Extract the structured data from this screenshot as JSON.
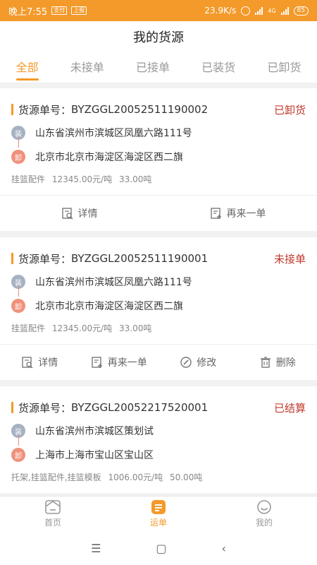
{
  "statusbar": {
    "time": "晚上7:55",
    "chip1": "支付",
    "chip2": "上报",
    "speed": "23.9K/s",
    "network": "4G",
    "battery": "85"
  },
  "title": "我的货源",
  "tabs": [
    "全部",
    "未接单",
    "已接单",
    "已装货",
    "已卸货"
  ],
  "orders": [
    {
      "no_label": "货源单号：",
      "no": "BYZGGL20052511190002",
      "status": "已卸货",
      "load_tag": "装",
      "unload_tag": "卸",
      "load_addr": "山东省滨州市滨城区凤凰六路111号",
      "unload_addr": "北京市北京市海淀区海淀区西二旗",
      "goods": "挂篮配件",
      "price": "12345.00元/吨",
      "weight": "33.00吨",
      "actions": [
        "详情",
        "再来一单"
      ]
    },
    {
      "no_label": "货源单号：",
      "no": "BYZGGL20052511190001",
      "status": "未接单",
      "load_tag": "装",
      "unload_tag": "卸",
      "load_addr": "山东省滨州市滨城区凤凰六路111号",
      "unload_addr": "北京市北京市海淀区海淀区西二旗",
      "goods": "挂篮配件",
      "price": "12345.00元/吨",
      "weight": "33.00吨",
      "actions": [
        "详情",
        "再来一单",
        "修改",
        "删除"
      ]
    },
    {
      "no_label": "货源单号：",
      "no": "BYZGGL20052217520001",
      "status": "已结算",
      "load_tag": "装",
      "unload_tag": "卸",
      "load_addr": "山东省滨州市滨城区策划试",
      "unload_addr": "上海市上海市宝山区宝山区",
      "goods": "托架,挂篮配件,挂篮模板",
      "price": "1006.00元/吨",
      "weight": "50.00吨"
    }
  ],
  "bottomnav": [
    "首页",
    "运单",
    "我的"
  ],
  "colors": {
    "accent": "#f39a2b",
    "status": "#c0392b",
    "load": "#a6b1c2",
    "unload": "#f0917b"
  }
}
